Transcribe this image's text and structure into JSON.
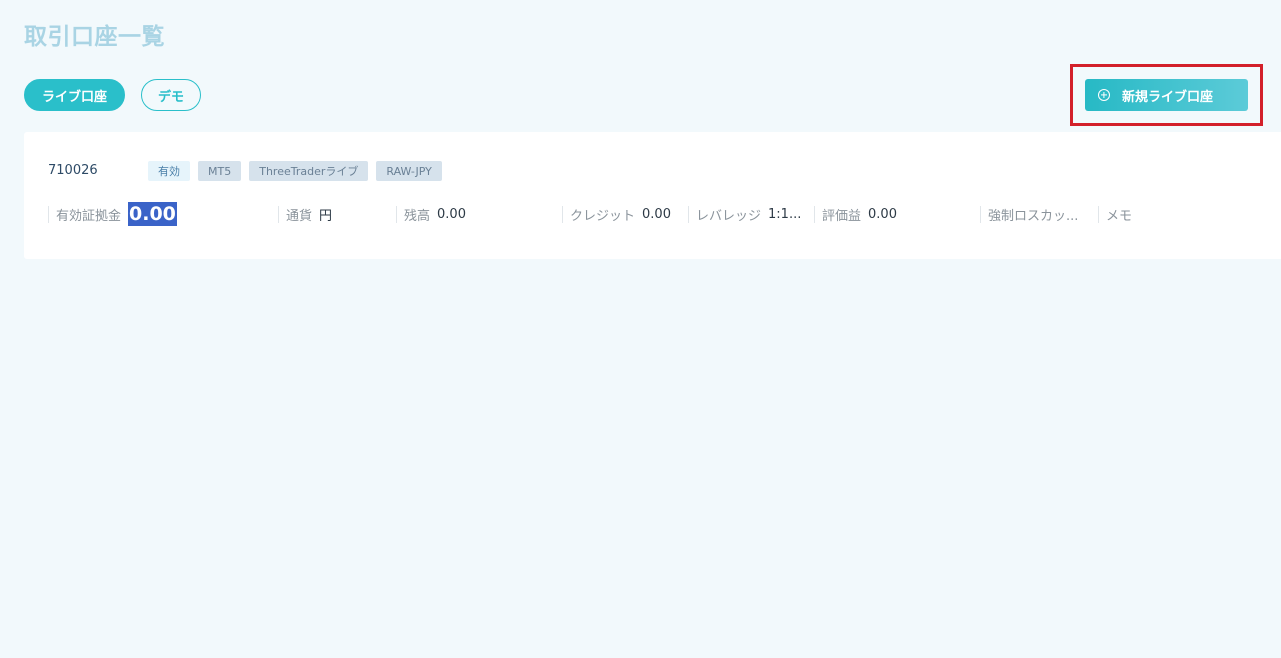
{
  "page": {
    "title": "取引口座一覧"
  },
  "tabs": [
    {
      "label": "ライブ口座",
      "active": true
    },
    {
      "label": "デモ",
      "active": false
    }
  ],
  "new_account_button": {
    "label": "新規ライブ口座",
    "icon": "plus-circle-icon"
  },
  "colors": {
    "accent": "#2abfca",
    "background": "#f2f9fc",
    "highlight_border": "#d3202a",
    "selection": "#3a63c8"
  },
  "account": {
    "number": "710026",
    "badges": [
      "有効",
      "MT5",
      "ThreeTraderライブ",
      "RAW-JPY"
    ],
    "fields": [
      {
        "label": "有効証拠金",
        "value": "0.00"
      },
      {
        "label": "通貨",
        "value": "円"
      },
      {
        "label": "残高",
        "value": "0.00"
      },
      {
        "label": "クレジット",
        "value": "0.00"
      },
      {
        "label": "レバレッジ",
        "value": "1:1..."
      },
      {
        "label": "評価益",
        "value": "0.00"
      },
      {
        "label": "強制ロスカッ...",
        "value": ""
      },
      {
        "label": "メモ",
        "value": ""
      }
    ]
  }
}
